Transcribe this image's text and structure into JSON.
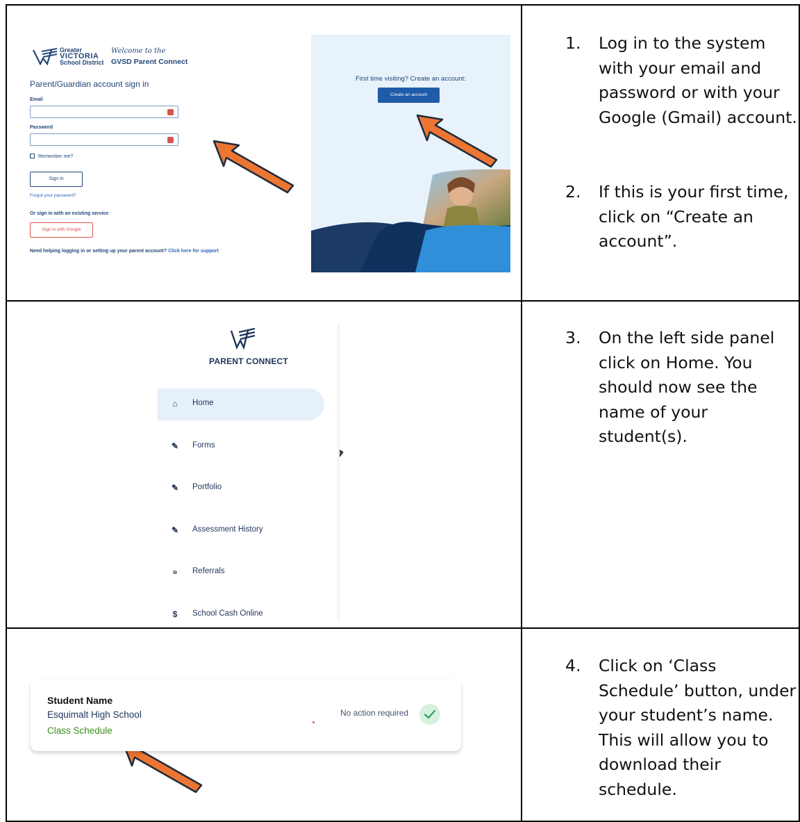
{
  "steps": [
    {
      "number": "1.",
      "text": "Log in to the system with your email and password or with your Google (Gmail) account."
    },
    {
      "number": "2.",
      "text": "If this is your first time, click on “Create an account”."
    },
    {
      "number": "3.",
      "text": "On the left side panel click on Home. You should now see the name of your student(s)."
    },
    {
      "number": "4.",
      "text": "Click on ‘Class Schedule’ button, under your student’s name. This will allow you to download their schedule."
    }
  ],
  "login": {
    "district_line1": "Greater",
    "district_line2": "VICTORIA",
    "district_line3": "School District",
    "welcome": "Welcome to the",
    "portal_name": "GVSD Parent Connect",
    "heading": "Parent/Guardian account sign in",
    "email_label": "Email",
    "password_label": "Password",
    "remember": "Remember me?",
    "signin_button": "Sign in",
    "forgot": "Forgot your password?",
    "or_service": "Or sign in with an existing service",
    "google_button": "Sign in with Google",
    "support_text": "Need helping logging in or setting up your parent account?",
    "support_link": "Click here for support",
    "first_time": "First time visiting? Create an account:",
    "create_button": "Create an account"
  },
  "nav": {
    "title": "PARENT CONNECT",
    "items": [
      {
        "label": "Home",
        "icon": "home-icon",
        "glyph": "⌂"
      },
      {
        "label": "Forms",
        "icon": "pen-icon",
        "glyph": "✎"
      },
      {
        "label": "Portfolio",
        "icon": "pen-icon",
        "glyph": "✎"
      },
      {
        "label": "Assessment History",
        "icon": "pen-icon",
        "glyph": "✎"
      },
      {
        "label": "Referrals",
        "icon": "double-chevron-icon",
        "glyph": "»"
      },
      {
        "label": "School Cash Online",
        "icon": "dollar-icon",
        "glyph": "$"
      }
    ]
  },
  "student_card": {
    "name": "Student Name",
    "school": "Esquimalt High School",
    "schedule_link": "Class Schedule",
    "status": "No action required"
  },
  "colors": {
    "arrow_fill": "#ed7532",
    "arrow_stroke": "#1e2a3a",
    "navy": "#24477a",
    "green": "#3b8f1e"
  }
}
